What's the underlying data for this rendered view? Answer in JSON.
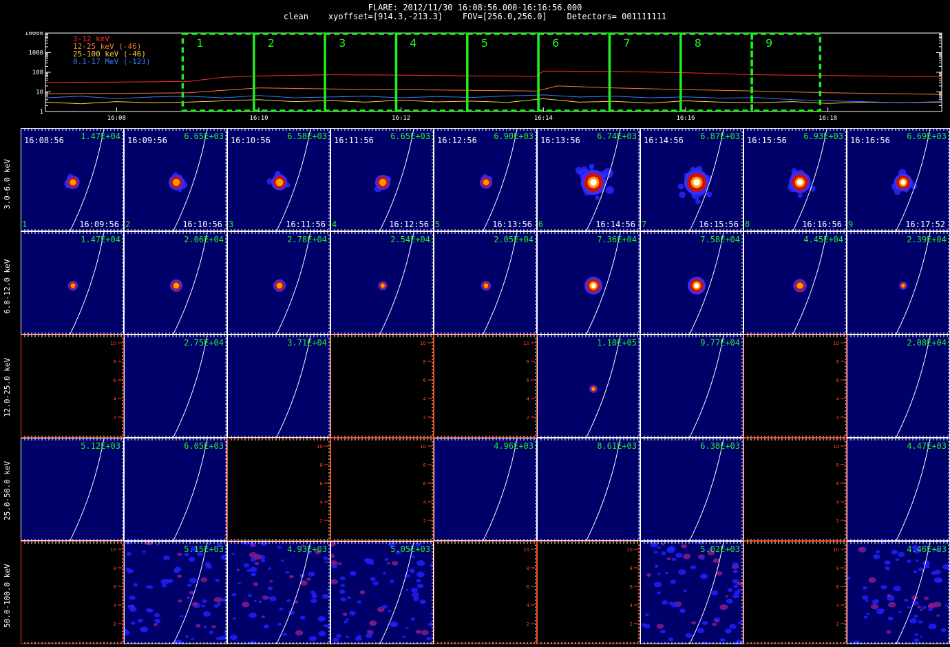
{
  "header": {
    "line1": "FLARE: 2012/11/30 16:08:56.000-16:16:56.000",
    "line2": "clean    xyoffset=[914.3,-213.3]    FOV=[256.0,256.0]    Detectors= 001111111"
  },
  "colors": {
    "c1": "#ff2a2a",
    "c2": "#ff7a2a",
    "c3": "#ffd040",
    "c4": "#3a78ff",
    "box": "#22ee22",
    "green": "#22ee22"
  },
  "chart_data": [
    {
      "type": "line",
      "y_scale": "log",
      "ylim": [
        1,
        10000
      ],
      "ytick_labels": [
        "1",
        "10",
        "100",
        "1000",
        "10000"
      ],
      "xtick_labels": [
        "16:08",
        "16:10",
        "16:12",
        "16:14",
        "16:16",
        "16:18"
      ],
      "xtick_minutes": [
        8,
        10,
        12,
        14,
        16,
        18
      ],
      "xlim_minutes": [
        7.0,
        19.6
      ],
      "series": [
        {
          "name": "3-12 keV",
          "color": "#ff2a2a",
          "x": [
            7.0,
            8.2,
            9.0,
            9.5,
            10.0,
            11.0,
            12.0,
            13.0,
            13.9,
            14.0,
            15.0,
            16.0,
            17.0,
            18.0,
            19.0,
            19.6
          ],
          "y": [
            30,
            32,
            34,
            55,
            65,
            75,
            72,
            65,
            62,
            115,
            110,
            95,
            75,
            68,
            62,
            60
          ]
        },
        {
          "name": "12-25 keV (-46)",
          "color": "#ff7a2a",
          "x": [
            7.0,
            8.2,
            9.0,
            9.5,
            10.0,
            11.0,
            12.0,
            13.0,
            13.9,
            14.2,
            15.0,
            16.0,
            17.0,
            18.0,
            19.0,
            19.6
          ],
          "y": [
            8,
            8.5,
            9,
            12,
            16,
            14,
            13,
            12,
            11,
            20,
            16,
            13,
            11,
            9,
            8,
            7.5
          ]
        },
        {
          "name": "25-100 keV (-46)",
          "color": "#ffd040",
          "x": [
            7.0,
            7.5,
            8.0,
            8.5,
            9.0,
            9.5,
            10.0,
            10.5,
            11.0,
            11.5,
            12.0,
            12.5,
            13.0,
            13.5,
            14.0,
            14.5,
            15.0,
            15.5,
            16.0,
            16.5,
            17.0,
            17.5,
            18.0,
            18.5,
            19.0,
            19.6
          ],
          "y": [
            3,
            2.5,
            3.2,
            2.8,
            3,
            3.5,
            4,
            3.2,
            3.6,
            3,
            3.8,
            3.1,
            3.4,
            2.9,
            4.5,
            3,
            3.3,
            2.7,
            3.5,
            3,
            2.8,
            3.2,
            2.6,
            3,
            2.8,
            3
          ]
        },
        {
          "name": "0.1-17 MeV (-123)",
          "color": "#3a78ff",
          "x": [
            7.0,
            7.5,
            8.0,
            8.5,
            9.0,
            9.5,
            10.0,
            10.5,
            11.0,
            11.5,
            12.0,
            12.5,
            13.0,
            13.5,
            14.0,
            14.5,
            15.0,
            15.5,
            16.0,
            16.5,
            17.0,
            17.5,
            18.0,
            18.5,
            19.0,
            19.6
          ],
          "y": [
            5,
            6,
            4.5,
            5.5,
            6,
            5,
            6.5,
            5,
            5.5,
            6,
            5,
            5.8,
            5.2,
            6.2,
            7,
            5.5,
            6,
            5,
            5.6,
            4.8,
            5.2,
            4,
            3.5,
            3.2,
            2.8,
            3.2
          ]
        }
      ],
      "intervals": [
        "1",
        "2",
        "3",
        "4",
        "5",
        "6",
        "7",
        "8",
        "9"
      ],
      "interval_edges_minutes": [
        8.93,
        9.93,
        10.93,
        11.93,
        12.93,
        13.93,
        14.93,
        15.93,
        16.93,
        17.89
      ]
    },
    {
      "type": "heatmap",
      "rows": [
        "3.0-6.0 keV",
        "6.0-12.0 keV",
        "12.0-25.0 keV",
        "25.0-50.0 keV",
        "50.0-100.0 keV"
      ],
      "start_times": [
        "16:08:56",
        "16:09:56",
        "16:10:56",
        "16:11:56",
        "16:12:56",
        "16:13:56",
        "16:14:56",
        "16:15:56",
        "16:16:56"
      ],
      "end_times": [
        "16:09:56",
        "16:10:56",
        "16:11:56",
        "16:12:56",
        "16:13:56",
        "16:14:56",
        "16:15:56",
        "16:16:56",
        "16:17:52"
      ],
      "interval_numbers": [
        "1",
        "2",
        "3",
        "4",
        "5",
        "6",
        "7",
        "8",
        "9"
      ],
      "peaks": [
        [
          "1.47E+04",
          "6.65E+03",
          "6.58E+03",
          "6.65E+03",
          "6.90E+03",
          "6.74E+03",
          "6.87E+03",
          "6.93E+03",
          "6.69E+03"
        ],
        [
          "1.47E+04",
          "2.06E+04",
          "2.78E+04",
          "2.54E+04",
          "2.05E+04",
          "7.36E+04",
          "7.58E+04",
          "4.45E+04",
          "2.39E+04"
        ],
        [
          "",
          "2.75E+04",
          "3.71E+04",
          "",
          "",
          "1.10E+05",
          "9.77E+04",
          "",
          "2.08E+04"
        ],
        [
          "5.12E+03",
          "6.05E+03",
          "",
          "",
          "4.96E+03",
          "8.61E+03",
          "6.38E+03",
          "",
          "4.47E+03"
        ],
        [
          "",
          "5.15E+03",
          "4.93E+03",
          "5.05E+03",
          "",
          "",
          "5.02E+03",
          "",
          "4.46E+03"
        ]
      ],
      "source_strength": [
        [
          0.35,
          0.45,
          0.5,
          0.45,
          0.3,
          1.0,
          1.0,
          0.8,
          0.6
        ],
        [
          0.15,
          0.3,
          0.3,
          0.1,
          0.15,
          0.6,
          0.6,
          0.35,
          0.05
        ],
        [
          0,
          0,
          0,
          0,
          0,
          0.05,
          0,
          0,
          0
        ],
        [
          0,
          0,
          0,
          0,
          0,
          0,
          0,
          0,
          0
        ],
        [
          0,
          0.5,
          0.6,
          0.6,
          0,
          0,
          0.6,
          0,
          0.6
        ]
      ],
      "empty_tick_labels": [
        "2",
        "4",
        "6",
        "8",
        "10"
      ]
    }
  ]
}
